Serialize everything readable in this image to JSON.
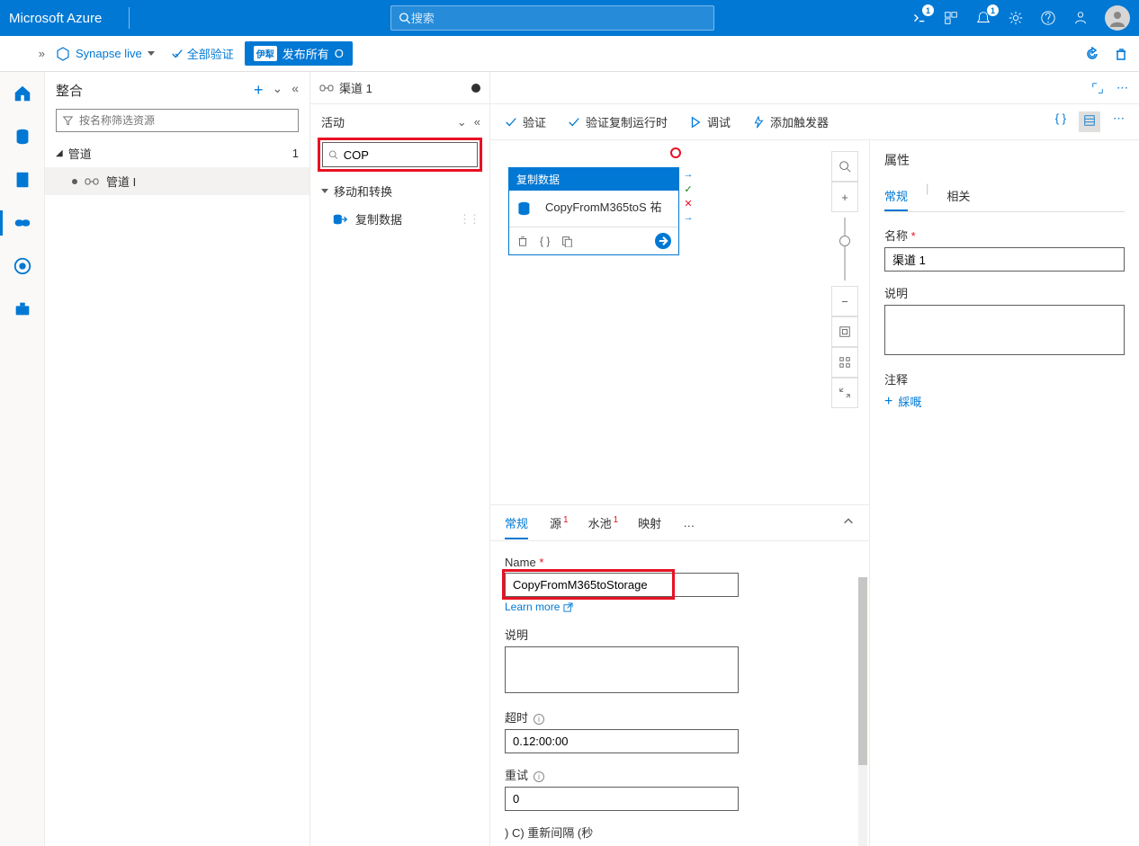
{
  "header": {
    "logo": "Microsoft Azure",
    "search_placeholder": "搜索",
    "badge_cloud": "1",
    "badge_bell": "1"
  },
  "toolbar": {
    "synapse_live": "Synapse live",
    "validate_all": "全部验证",
    "publish_tag": "伊犁",
    "publish_label": "发布所有",
    "publish_count": "O"
  },
  "tree": {
    "title": "整合",
    "filter_placeholder": "按名称筛选资源",
    "group": "管道",
    "group_count": "1",
    "item": "管道 I"
  },
  "activities": {
    "tab_label": "渠道 1",
    "title": "活动",
    "search_value": "COP",
    "group": "移动和转换",
    "item": "复制数据"
  },
  "canvasToolbar": {
    "validate": "验证",
    "validate_runtime": "验证复制运行时",
    "debug": "调试",
    "add_trigger": "添加触发器"
  },
  "node": {
    "header": "复制数据",
    "name": "CopyFromM365toS 祐"
  },
  "bottomTabs": {
    "general": "常规",
    "source": "源",
    "sink": "水池",
    "mapping": "映射",
    "more": "…",
    "source_badge": "1",
    "sink_badge": "1"
  },
  "form": {
    "name_label": "Name",
    "name_value": "CopyFromM365toStorage",
    "learn_more": "Learn more",
    "desc_label": "说明",
    "timeout_label": "超时",
    "timeout_value": "0.12:00:00",
    "retry_label": "重试",
    "retry_value": "0",
    "retry_interval_label": ") C) 重新间隔 (秒"
  },
  "props": {
    "title": "属性",
    "tab_general": "常规",
    "tab_related": "相关",
    "name_label": "名称",
    "name_value": "渠道 1",
    "desc_label": "说明",
    "annotations_label": "注释",
    "add_new": "綵嘅"
  }
}
